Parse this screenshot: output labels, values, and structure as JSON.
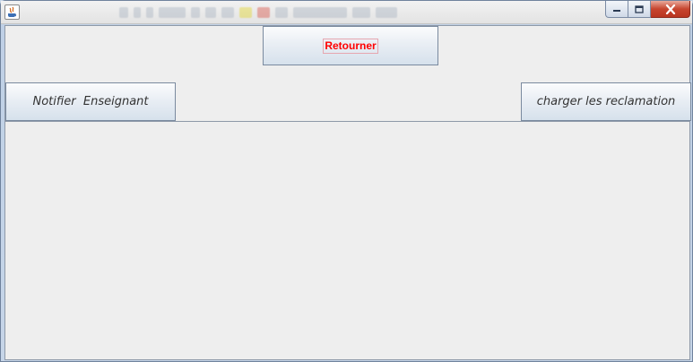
{
  "window": {
    "title": "",
    "controls": {
      "minimize_icon": "minimize-icon",
      "maximize_icon": "maximize-icon",
      "close_icon": "close-icon"
    }
  },
  "buttons": {
    "back": "Retourner",
    "notify": "Notifier  Enseignant",
    "load": "charger les reclamation"
  },
  "colors": {
    "back_label": "#ff0000",
    "client_bg": "#eeeeee",
    "close_button": "#c7452f"
  }
}
